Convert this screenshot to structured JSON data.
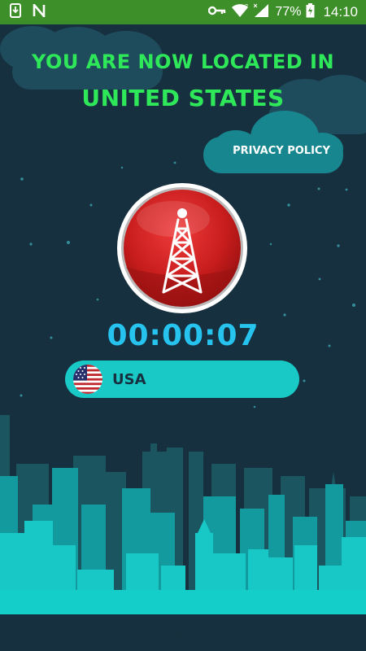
{
  "status_bar": {
    "icons_left": [
      "download-icon",
      "n-app-icon"
    ],
    "icons_right": [
      "key-icon",
      "wifi-icon",
      "signal-icon",
      "battery-icon"
    ],
    "battery_percent": "77%",
    "time": "14:10"
  },
  "headline": {
    "line1": "YOU ARE NOW LOCATED IN",
    "line2": "UNITED STATES"
  },
  "privacy_policy_label": "PRIVACY POLICY",
  "connect_button": {
    "icon": "radio-tower-icon",
    "color": "#c81d1d"
  },
  "timer": "00:00:07",
  "country": {
    "name": "USA",
    "flag": "us-flag-icon"
  },
  "nav": {
    "buttons": [
      "back-icon",
      "home-icon",
      "recents-icon"
    ]
  },
  "colors": {
    "status_bar": "#3d8f29",
    "background": "#17303f",
    "headline": "#2ee85a",
    "timer": "#25c3ee",
    "country_pill": "#18c9c6",
    "city": "#16c4c4"
  }
}
